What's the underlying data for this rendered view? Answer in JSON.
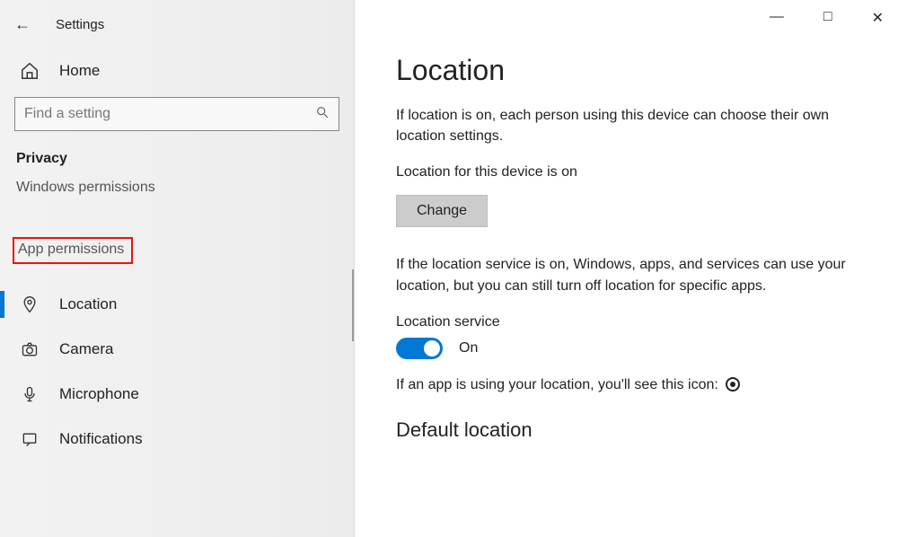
{
  "app": {
    "title": "Settings"
  },
  "search": {
    "placeholder": "Find a setting"
  },
  "sidebar": {
    "home": "Home",
    "privacy_header": "Privacy",
    "windows_permissions": "Windows permissions",
    "app_permissions": "App permissions",
    "items": [
      {
        "label": "Location",
        "icon": "location-icon",
        "active": true
      },
      {
        "label": "Camera",
        "icon": "camera-icon"
      },
      {
        "label": "Microphone",
        "icon": "microphone-icon"
      },
      {
        "label": "Notifications",
        "icon": "notifications-icon"
      }
    ]
  },
  "main": {
    "title": "Location",
    "intro": "If location is on, each person using this device can choose their own location settings.",
    "device_status": "Location for this device is on",
    "change_label": "Change",
    "service_desc": "If the location service is on, Windows, apps, and services can use your location, but you can still turn off location for specific apps.",
    "service_label": "Location service",
    "toggle_state": "On",
    "icon_note": "If an app is using your location, you'll see this icon:",
    "default_location": "Default location"
  },
  "window_controls": {
    "minimize": "—",
    "maximize": "□",
    "close": "✕"
  }
}
